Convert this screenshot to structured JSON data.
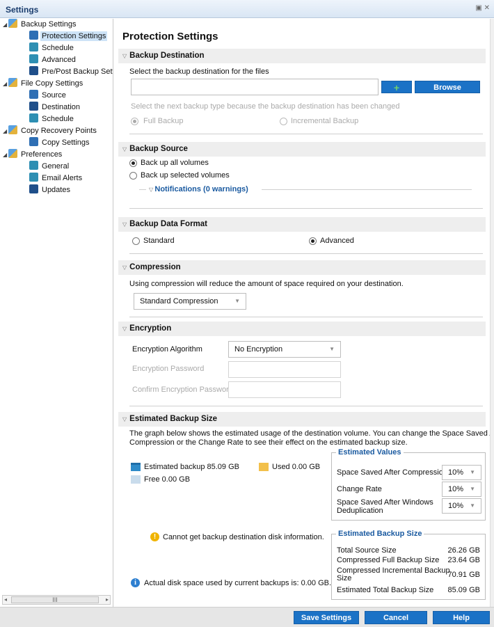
{
  "window": {
    "title": "Settings"
  },
  "tree": {
    "items": [
      {
        "label": "Backup Settings",
        "level": 0,
        "icon": "backup-settings-icon",
        "toggle": "◢"
      },
      {
        "label": "Protection Settings",
        "level": 1,
        "icon": "protection-icon",
        "selected": true
      },
      {
        "label": "Schedule",
        "level": 1,
        "icon": "schedule-icon"
      },
      {
        "label": "Advanced",
        "level": 1,
        "icon": "advanced-icon"
      },
      {
        "label": "Pre/Post Backup Settin",
        "level": 1,
        "icon": "pre-post-icon"
      },
      {
        "label": "File Copy Settings",
        "level": 0,
        "icon": "file-copy-icon",
        "toggle": "◢"
      },
      {
        "label": "Source",
        "level": 1,
        "icon": "source-icon"
      },
      {
        "label": "Destination",
        "level": 1,
        "icon": "destination-icon"
      },
      {
        "label": "Schedule",
        "level": 1,
        "icon": "schedule-icon"
      },
      {
        "label": "Copy Recovery Points",
        "level": 0,
        "icon": "copy-recovery-icon",
        "toggle": "◢"
      },
      {
        "label": "Copy Settings",
        "level": 1,
        "icon": "copy-settings-icon"
      },
      {
        "label": "Preferences",
        "level": 0,
        "icon": "preferences-icon",
        "toggle": "◢"
      },
      {
        "label": "General",
        "level": 1,
        "icon": "general-icon"
      },
      {
        "label": "Email Alerts",
        "level": 1,
        "icon": "email-icon"
      },
      {
        "label": "Updates",
        "level": 1,
        "icon": "updates-icon"
      }
    ],
    "scroll_thumb": "III"
  },
  "page": {
    "title": "Protection Settings"
  },
  "destination": {
    "header": "Backup Destination",
    "prompt": "Select the backup destination for the files",
    "path_value": "",
    "add_label": "+",
    "browse_label": "Browse",
    "note": "Select the next backup type because the backup destination has been changed",
    "full_backup": "Full Backup",
    "incremental_backup": "Incremental Backup"
  },
  "source": {
    "header": "Backup Source",
    "all_volumes": "Back up all volumes",
    "selected_volumes": "Back up selected volumes",
    "notifications": "Notifications (0 warnings)"
  },
  "format": {
    "header": "Backup Data Format",
    "standard": "Standard",
    "advanced": "Advanced"
  },
  "compression": {
    "header": "Compression",
    "description": "Using compression will reduce the amount of space required on your destination.",
    "selected": "Standard Compression"
  },
  "encryption": {
    "header": "Encryption",
    "algorithm_label": "Encryption Algorithm",
    "algorithm_value": "No Encryption",
    "password_label": "Encryption Password",
    "confirm_label": "Confirm Encryption Password"
  },
  "estimated": {
    "header": "Estimated Backup Size",
    "description_1": "The graph below shows the estimated usage of the destination volume. You can change the Space Saved After",
    "description_2": "Compression or the Change Rate to see their effect on the estimated backup size.",
    "legend_backup": "Estimated backup 85.09 GB",
    "legend_used": "Used 0.00 GB",
    "legend_free": "Free 0.00 GB",
    "warning": "Cannot get backup destination disk information.",
    "info": "Actual disk space used by current backups is: 0.00 GB.",
    "values_title": "Estimated Values",
    "space_saved_label": "Space Saved After Compression",
    "space_saved_value": "10%",
    "change_rate_label": "Change Rate",
    "change_rate_value": "10%",
    "dedup_label_1": "Space Saved After Windows",
    "dedup_label_2": "Deduplication",
    "dedup_value": "10%",
    "size_title": "Estimated Backup Size",
    "total_source_label": "Total Source Size",
    "total_source_value": "26.26 GB",
    "compressed_full_label": "Compressed Full Backup Size",
    "compressed_full_value": "23.64 GB",
    "compressed_incr_label_1": "Compressed Incremental Backup",
    "compressed_incr_label_2": "Size",
    "compressed_incr_value": "70.91 GB",
    "estimated_total_label": "Estimated Total Backup Size",
    "estimated_total_value": "85.09 GB"
  },
  "footer": {
    "save_label": "Save Settings",
    "cancel_label": "Cancel",
    "help_label": "Help"
  },
  "colors": {
    "accent": "#1b72c6",
    "legend_backup": "#2e8bc9",
    "legend_used": "#f2c04b",
    "legend_free": "#c9dcec"
  }
}
